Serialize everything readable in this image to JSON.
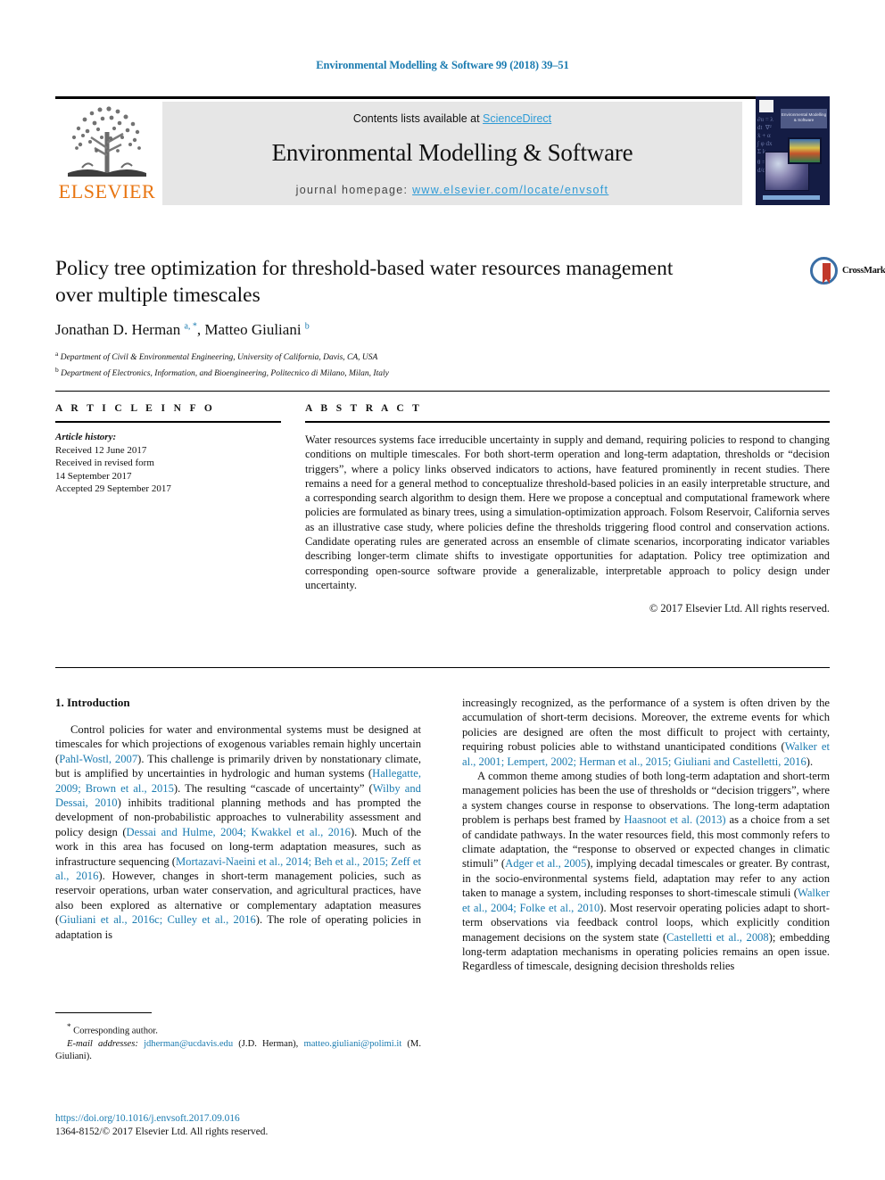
{
  "running_head": "Environmental Modelling & Software 99 (2018) 39–51",
  "masthead": {
    "contents_prefix": "Contents lists available at ",
    "sciencedirect": "ScienceDirect",
    "journal_title": "Environmental Modelling & Software",
    "homepage_prefix": "journal homepage: ",
    "homepage_url": "www.elsevier.com/locate/envsoft",
    "publisher": "ELSEVIER",
    "cover_title": "Environmental Modelling & Software"
  },
  "article": {
    "title": "Policy tree optimization for threshold-based water resources management over multiple timescales",
    "authors_pre": "Jonathan D. Herman ",
    "author1_sup": "a, *",
    "authors_mid": ", Matteo Giuliani ",
    "author2_sup": "b",
    "affiliation_a_sup": "a",
    "affiliation_a": "Department of Civil & Environmental Engineering, University of California, Davis, CA, USA",
    "affiliation_b_sup": "b",
    "affiliation_b": "Department of Electronics, Information, and Bioengineering, Politecnico di Milano, Milan, Italy",
    "crossmark_label": "CrossMark"
  },
  "article_info": {
    "heading": "A R T I C L E   I N F O",
    "history_label": "Article history:",
    "received": "Received 12 June 2017",
    "revised_label": "Received in revised form",
    "revised_date": "14 September 2017",
    "accepted": "Accepted 29 September 2017"
  },
  "abstract": {
    "heading": "A B S T R A C T",
    "text": "Water resources systems face irreducible uncertainty in supply and demand, requiring policies to respond to changing conditions on multiple timescales. For both short-term operation and long-term adaptation, thresholds or “decision triggers”, where a policy links observed indicators to actions, have featured prominently in recent studies. There remains a need for a general method to conceptualize threshold-based policies in an easily interpretable structure, and a corresponding search algorithm to design them. Here we propose a conceptual and computational framework where policies are formulated as binary trees, using a simulation-optimization approach. Folsom Reservoir, California serves as an illustrative case study, where policies define the thresholds triggering flood control and conservation actions. Candidate operating rules are generated across an ensemble of climate scenarios, incorporating indicator variables describing longer-term climate shifts to investigate opportunities for adaptation. Policy tree optimization and corresponding open-source software provide a generalizable, interpretable approach to policy design under uncertainty.",
    "copyright": "© 2017 Elsevier Ltd. All rights reserved."
  },
  "intro": {
    "heading": "1. Introduction",
    "left_p1_a": "Control policies for water and environmental systems must be designed at timescales for which projections of exogenous variables remain highly uncertain (",
    "left_c1": "Pahl-Wostl, 2007",
    "left_p1_b": "). This challenge is primarily driven by nonstationary climate, but is amplified by uncertainties in hydrologic and human systems (",
    "left_c2": "Hallegatte, 2009; Brown et al., 2015",
    "left_p1_c": "). The resulting “cascade of uncertainty” (",
    "left_c3": "Wilby and Dessai, 2010",
    "left_p1_d": ") inhibits traditional planning methods and has prompted the development of non-probabilistic approaches to vulnerability assessment and policy design (",
    "left_c4": "Dessai and Hulme, 2004; Kwakkel et al., 2016",
    "left_p1_e": "). Much of the work in this area has focused on long-term adaptation measures, such as infrastructure sequencing (",
    "left_c5": "Mortazavi-Naeini et al., 2014; Beh et al., 2015; Zeff et al., 2016",
    "left_p1_f": "). However, changes in short-term management policies, such as reservoir operations, urban water conservation, and agricultural practices, have also been explored as alternative or complementary adaptation measures (",
    "left_c6": "Giuliani et al., 2016c; Culley et al., 2016",
    "left_p1_g": "). The role of operating policies in adaptation is",
    "right_p1_a": "increasingly recognized, as the performance of a system is often driven by the accumulation of short-term decisions. Moreover, the extreme events for which policies are designed are often the most difficult to project with certainty, requiring robust policies able to withstand unanticipated conditions (",
    "right_c1": "Walker et al., 2001; Lempert, 2002; Herman et al., 2015; Giuliani and Castelletti, 2016",
    "right_p1_b": ").",
    "right_p2_a": "A common theme among studies of both long-term adaptation and short-term management policies has been the use of thresholds or “decision triggers”, where a system changes course in response to observations. The long-term adaptation problem is perhaps best framed by ",
    "right_c2": "Haasnoot et al. (2013)",
    "right_p2_b": " as a choice from a set of candidate pathways. In the water resources field, this most commonly refers to climate adaptation, the “response to observed or expected changes in climatic stimuli” (",
    "right_c3": "Adger et al., 2005",
    "right_p2_c": "), implying decadal timescales or greater. By contrast, in the socio-environmental systems field, adaptation may refer to any action taken to manage a system, including responses to short-timescale stimuli (",
    "right_c4": "Walker et al., 2004; Folke et al., 2010",
    "right_p2_d": "). Most reservoir operating policies adapt to short-term observations via feedback control loops, which explicitly condition management decisions on the system state (",
    "right_c5": "Castelletti et al., 2008",
    "right_p2_e": "); embedding long-term adaptation mechanisms in operating policies remains an open issue. Regardless of timescale, designing decision thresholds relies"
  },
  "footnotes": {
    "corresponding": "Corresponding author.",
    "email_label": "E-mail addresses:",
    "email1": "jdherman@ucdavis.edu",
    "email1_owner": " (J.D. Herman), ",
    "email2": "matteo.giuliani@polimi.it",
    "email2_owner": " (M. Giuliani).",
    "doi": "https://doi.org/10.1016/j.envsoft.2017.09.016",
    "issn": "1364-8152/© 2017 Elsevier Ltd. All rights reserved."
  },
  "colors": {
    "link": "#1a7bb0",
    "sciencedirect": "#2e9bd6",
    "elsevier_orange": "#e87511",
    "band_gray": "#e6e6e6"
  }
}
